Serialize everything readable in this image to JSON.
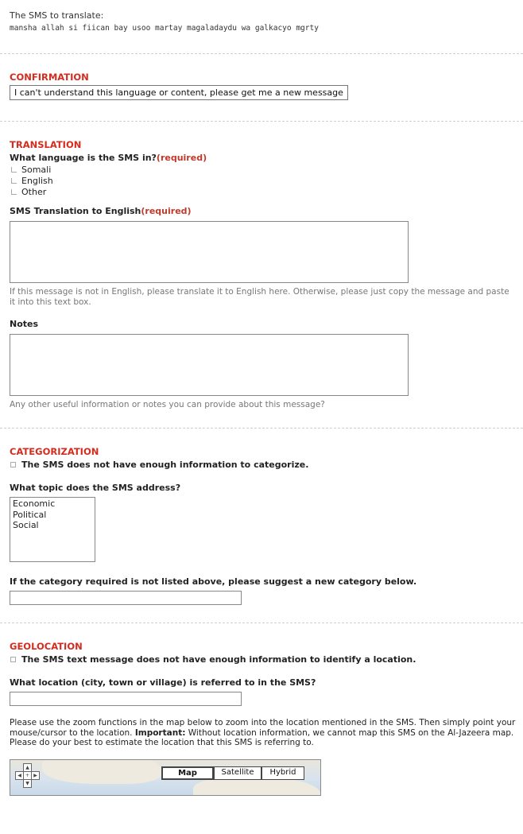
{
  "sms": {
    "intro": "The SMS to translate:",
    "text": "mansha allah si fiican bay usoo martay magaladaydu wa galkacyo mgrty"
  },
  "confirmation": {
    "title": "CONFIRMATION",
    "button_label": "I can't understand this language or content, please get me a new message"
  },
  "translation": {
    "title": "TRANSLATION",
    "language_question": "What language is the SMS in?",
    "required": "(required)",
    "languages": [
      "Somali",
      "English",
      "Other"
    ],
    "translation_label": "SMS Translation to English",
    "translation_hint": "If this message is not in English, please translate it to English here. Otherwise, please just copy the message and paste it into this text box.",
    "notes_label": "Notes",
    "notes_hint": "Any other useful information or notes you can provide about this message?"
  },
  "categorization": {
    "title": "CATEGORIZATION",
    "not_enough_info": "The SMS does not have enough information to categorize.",
    "topic_question": "What topic does the SMS address?",
    "topics": [
      "Economic",
      "Political",
      "Social"
    ],
    "suggest_label": "If the category required is not listed above, please suggest a new category below."
  },
  "geolocation": {
    "title": "GEOLOCATION",
    "not_enough_info": "The SMS text message does not have enough information to identify a location.",
    "location_question": "What location (city, town or village) is referred to in the SMS?",
    "instructions_pre": "Please use the zoom functions in the map below to zoom into the location mentioned in the SMS. Then simply point your mouse/cursor to the location. ",
    "instructions_important": "Important:",
    "instructions_post": " Without location information, we cannot map this SMS on the Al-Jazeera map. Please do your best to estimate the location that this SMS is referring to.",
    "map_types": [
      "Map",
      "Satellite",
      "Hybrid"
    ],
    "selected_map_type": "Map"
  }
}
